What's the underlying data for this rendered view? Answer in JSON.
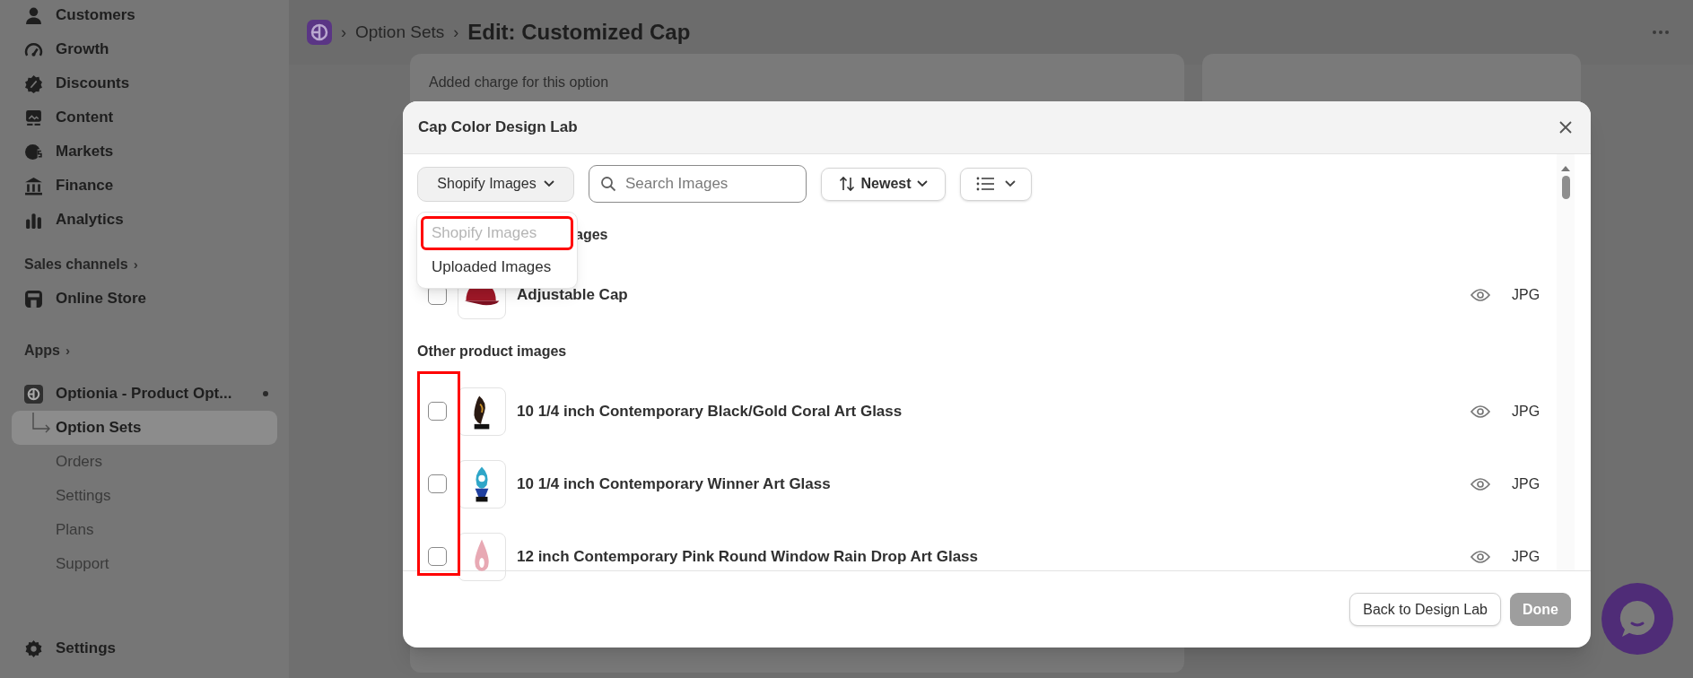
{
  "sidebar": {
    "items": [
      {
        "kind": "nav",
        "label": "Customers",
        "selected": false
      },
      {
        "kind": "nav",
        "label": "Growth",
        "selected": false
      },
      {
        "kind": "nav",
        "label": "Discounts",
        "selected": false
      },
      {
        "kind": "nav",
        "label": "Content",
        "selected": false
      },
      {
        "kind": "nav",
        "label": "Markets",
        "selected": false
      },
      {
        "kind": "nav",
        "label": "Finance",
        "selected": false
      },
      {
        "kind": "nav",
        "label": "Analytics",
        "selected": false
      },
      {
        "kind": "section",
        "label": "Sales channels",
        "selected": false,
        "chevron": "›"
      },
      {
        "kind": "nav",
        "label": "Online Store",
        "selected": false
      },
      {
        "kind": "section",
        "label": "Apps",
        "selected": false,
        "chevron": "›"
      },
      {
        "kind": "app",
        "label": "Optionia - Product Opt...",
        "selected": false,
        "notification": true
      },
      {
        "kind": "sub",
        "label": "Option Sets",
        "selected": true
      },
      {
        "kind": "sub",
        "label": "Orders",
        "selected": false
      },
      {
        "kind": "sub",
        "label": "Settings",
        "selected": false
      },
      {
        "kind": "sub",
        "label": "Plans",
        "selected": false
      },
      {
        "kind": "sub",
        "label": "Support",
        "selected": false
      }
    ],
    "footer": {
      "label": "Settings"
    }
  },
  "header": {
    "separators": [
      "›",
      "›"
    ],
    "breadcrumb": "Option Sets",
    "title": "Edit: Customized Cap"
  },
  "background_card": {
    "text": "Added charge for this option"
  },
  "modal": {
    "title": "Cap Color Design Lab",
    "source_dropdown": {
      "value": "Shopify Images",
      "options": [
        {
          "label": "Shopify Images",
          "disabled": true,
          "highlighted": true
        },
        {
          "label": "Uploaded Images",
          "disabled": false,
          "highlighted": false
        }
      ]
    },
    "search": {
      "placeholder": "Search Images"
    },
    "sort": {
      "value": "Newest"
    },
    "sections": [
      {
        "title": "ages",
        "items": [
          {
            "name": "Adjustable Cap",
            "format": "JPG",
            "checked": false,
            "kind": "cap"
          }
        ]
      },
      {
        "title": "Other product images",
        "checkboxes_highlighted": true,
        "items": [
          {
            "name": "10 1/4 inch Contemporary Black/Gold Coral Art Glass",
            "format": "JPG",
            "checked": false,
            "kind": "dark"
          },
          {
            "name": "10 1/4 inch Contemporary Winner Art Glass",
            "format": "JPG",
            "checked": false,
            "kind": "blue"
          },
          {
            "name": "12 inch Contemporary Pink Round Window Rain Drop Art Glass",
            "format": "JPG",
            "checked": false,
            "kind": "pink"
          }
        ]
      }
    ],
    "buttons": [
      {
        "label": "Back to Design Lab",
        "disabled": false
      },
      {
        "label": "Done",
        "disabled": true
      }
    ]
  }
}
